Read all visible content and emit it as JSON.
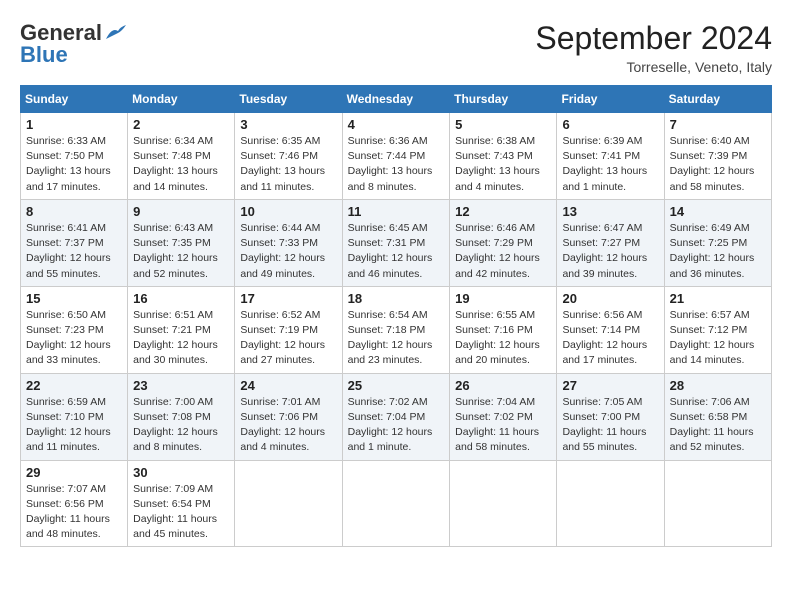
{
  "logo": {
    "line1": "General",
    "line2": "Blue"
  },
  "header": {
    "month": "September 2024",
    "location": "Torreselle, Veneto, Italy"
  },
  "weekdays": [
    "Sunday",
    "Monday",
    "Tuesday",
    "Wednesday",
    "Thursday",
    "Friday",
    "Saturday"
  ],
  "weeks": [
    [
      {
        "day": "1",
        "sunrise": "6:33 AM",
        "sunset": "7:50 PM",
        "daylight": "13 hours and 17 minutes."
      },
      {
        "day": "2",
        "sunrise": "6:34 AM",
        "sunset": "7:48 PM",
        "daylight": "13 hours and 14 minutes."
      },
      {
        "day": "3",
        "sunrise": "6:35 AM",
        "sunset": "7:46 PM",
        "daylight": "13 hours and 11 minutes."
      },
      {
        "day": "4",
        "sunrise": "6:36 AM",
        "sunset": "7:44 PM",
        "daylight": "13 hours and 8 minutes."
      },
      {
        "day": "5",
        "sunrise": "6:38 AM",
        "sunset": "7:43 PM",
        "daylight": "13 hours and 4 minutes."
      },
      {
        "day": "6",
        "sunrise": "6:39 AM",
        "sunset": "7:41 PM",
        "daylight": "13 hours and 1 minute."
      },
      {
        "day": "7",
        "sunrise": "6:40 AM",
        "sunset": "7:39 PM",
        "daylight": "12 hours and 58 minutes."
      }
    ],
    [
      {
        "day": "8",
        "sunrise": "6:41 AM",
        "sunset": "7:37 PM",
        "daylight": "12 hours and 55 minutes."
      },
      {
        "day": "9",
        "sunrise": "6:43 AM",
        "sunset": "7:35 PM",
        "daylight": "12 hours and 52 minutes."
      },
      {
        "day": "10",
        "sunrise": "6:44 AM",
        "sunset": "7:33 PM",
        "daylight": "12 hours and 49 minutes."
      },
      {
        "day": "11",
        "sunrise": "6:45 AM",
        "sunset": "7:31 PM",
        "daylight": "12 hours and 46 minutes."
      },
      {
        "day": "12",
        "sunrise": "6:46 AM",
        "sunset": "7:29 PM",
        "daylight": "12 hours and 42 minutes."
      },
      {
        "day": "13",
        "sunrise": "6:47 AM",
        "sunset": "7:27 PM",
        "daylight": "12 hours and 39 minutes."
      },
      {
        "day": "14",
        "sunrise": "6:49 AM",
        "sunset": "7:25 PM",
        "daylight": "12 hours and 36 minutes."
      }
    ],
    [
      {
        "day": "15",
        "sunrise": "6:50 AM",
        "sunset": "7:23 PM",
        "daylight": "12 hours and 33 minutes."
      },
      {
        "day": "16",
        "sunrise": "6:51 AM",
        "sunset": "7:21 PM",
        "daylight": "12 hours and 30 minutes."
      },
      {
        "day": "17",
        "sunrise": "6:52 AM",
        "sunset": "7:19 PM",
        "daylight": "12 hours and 27 minutes."
      },
      {
        "day": "18",
        "sunrise": "6:54 AM",
        "sunset": "7:18 PM",
        "daylight": "12 hours and 23 minutes."
      },
      {
        "day": "19",
        "sunrise": "6:55 AM",
        "sunset": "7:16 PM",
        "daylight": "12 hours and 20 minutes."
      },
      {
        "day": "20",
        "sunrise": "6:56 AM",
        "sunset": "7:14 PM",
        "daylight": "12 hours and 17 minutes."
      },
      {
        "day": "21",
        "sunrise": "6:57 AM",
        "sunset": "7:12 PM",
        "daylight": "12 hours and 14 minutes."
      }
    ],
    [
      {
        "day": "22",
        "sunrise": "6:59 AM",
        "sunset": "7:10 PM",
        "daylight": "12 hours and 11 minutes."
      },
      {
        "day": "23",
        "sunrise": "7:00 AM",
        "sunset": "7:08 PM",
        "daylight": "12 hours and 8 minutes."
      },
      {
        "day": "24",
        "sunrise": "7:01 AM",
        "sunset": "7:06 PM",
        "daylight": "12 hours and 4 minutes."
      },
      {
        "day": "25",
        "sunrise": "7:02 AM",
        "sunset": "7:04 PM",
        "daylight": "12 hours and 1 minute."
      },
      {
        "day": "26",
        "sunrise": "7:04 AM",
        "sunset": "7:02 PM",
        "daylight": "11 hours and 58 minutes."
      },
      {
        "day": "27",
        "sunrise": "7:05 AM",
        "sunset": "7:00 PM",
        "daylight": "11 hours and 55 minutes."
      },
      {
        "day": "28",
        "sunrise": "7:06 AM",
        "sunset": "6:58 PM",
        "daylight": "11 hours and 52 minutes."
      }
    ],
    [
      {
        "day": "29",
        "sunrise": "7:07 AM",
        "sunset": "6:56 PM",
        "daylight": "11 hours and 48 minutes."
      },
      {
        "day": "30",
        "sunrise": "7:09 AM",
        "sunset": "6:54 PM",
        "daylight": "11 hours and 45 minutes."
      },
      null,
      null,
      null,
      null,
      null
    ]
  ]
}
